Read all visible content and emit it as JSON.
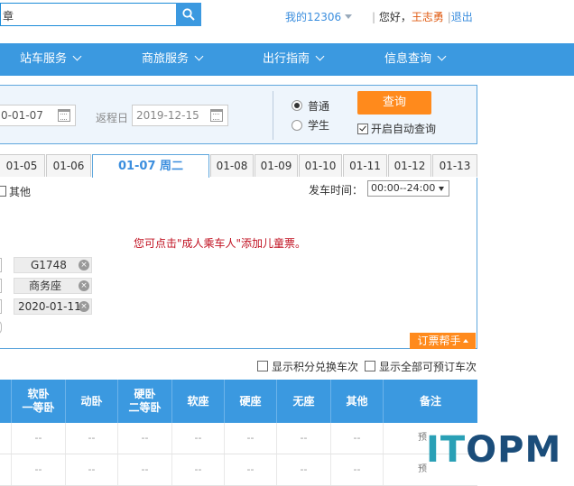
{
  "header": {
    "search_value": "章",
    "my_account": "我的12306",
    "greeting": "您好，",
    "username": "王志勇",
    "logout": "退出"
  },
  "nav": {
    "items": [
      {
        "label": "站车服务"
      },
      {
        "label": "商旅服务"
      },
      {
        "label": "出行指南"
      },
      {
        "label": "信息查询"
      }
    ]
  },
  "query": {
    "depart_date": "0-01-07",
    "return_label": "返程日",
    "return_date": "2019-12-15",
    "type_normal": "普通",
    "type_student": "学生",
    "query_button": "查询",
    "auto_query": "开启自动查询"
  },
  "date_tabs": [
    {
      "label": "01-05"
    },
    {
      "label": "01-06"
    },
    {
      "label": "01-07 周二",
      "active": true
    },
    {
      "label": "01-08"
    },
    {
      "label": "01-09"
    },
    {
      "label": "01-10"
    },
    {
      "label": "01-11"
    },
    {
      "label": "01-12"
    },
    {
      "label": "01-13"
    }
  ],
  "order": {
    "other_label": "其他",
    "departure_time_label": "发车时间：",
    "departure_time_value": "00:00--24:00",
    "hint": "您可点击\"成人乘车人\"添加儿童票。",
    "tags": [
      "G1748",
      "商务座",
      "2020-01-11"
    ],
    "help": "订票帮手"
  },
  "options": {
    "points_exchange": "显示积分兑换车次",
    "show_all_bookable": "显示全部可预订车次"
  },
  "table": {
    "headers": [
      {
        "line1": "软卧",
        "line2": "一等卧"
      },
      {
        "line1": "动卧",
        "line2": ""
      },
      {
        "line1": "硬卧",
        "line2": "二等卧"
      },
      {
        "line1": "软座",
        "line2": ""
      },
      {
        "line1": "硬座",
        "line2": ""
      },
      {
        "line1": "无座",
        "line2": ""
      },
      {
        "line1": "其他",
        "line2": ""
      },
      {
        "line1": "备注",
        "line2": ""
      }
    ],
    "rows": [
      [
        "--",
        "--",
        "--",
        "--",
        "--",
        "--",
        "--",
        "预"
      ],
      [
        "--",
        "--",
        "--",
        "--",
        "--",
        "--",
        "--",
        "预"
      ]
    ]
  },
  "watermark": {
    "part1": "IT",
    "part2": "OPM"
  },
  "colors": {
    "brand_blue": "#3b99e0",
    "accent_orange": "#ff8a1c",
    "hint_red": "#c01020"
  }
}
